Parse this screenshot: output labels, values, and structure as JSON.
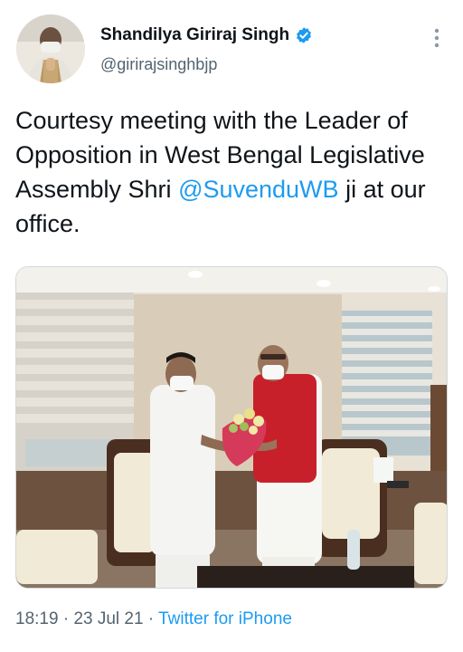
{
  "author": {
    "display_name": "Shandilya Giriraj Singh",
    "handle": "@girirajsinghbjp",
    "verified": true
  },
  "tweet": {
    "text_before": "Courtesy meeting with the Leader of Opposition in West Bengal Legislative Assembly Shri ",
    "mention": "@SuvenduWB",
    "text_after": " ji at our office."
  },
  "meta": {
    "time": "18:19",
    "separator": " · ",
    "date": "23 Jul 21",
    "source": "Twitter for iPhone"
  },
  "colors": {
    "link": "#1d9bf0",
    "secondary_text": "#536471",
    "verified_badge": "#1d9bf0"
  },
  "icons": [
    "verified-badge-icon",
    "more-options-icon"
  ]
}
